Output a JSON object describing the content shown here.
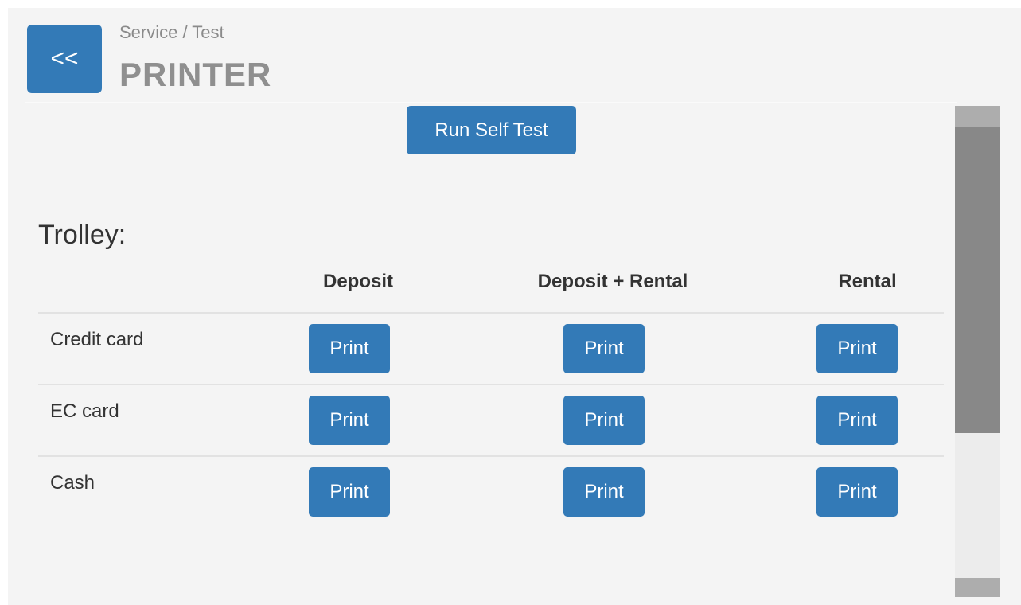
{
  "header": {
    "back_label": "<<",
    "breadcrumb": "Service / Test",
    "title": "PRINTER"
  },
  "self_test_label": "Run Self Test",
  "trolley": {
    "title": "Trolley:",
    "columns": [
      "Deposit",
      "Deposit + Rental",
      "Rental"
    ],
    "rows": [
      {
        "label": "Credit card",
        "buttons": [
          "Print",
          "Print",
          "Print"
        ]
      },
      {
        "label": "EC card",
        "buttons": [
          "Print",
          "Print",
          "Print"
        ]
      },
      {
        "label": "Cash",
        "buttons": [
          "Print",
          "Print",
          "Print"
        ]
      }
    ]
  },
  "colors": {
    "primary": "#337ab7",
    "panel_bg": "#f4f4f4",
    "title_gray": "#8f8f8f"
  }
}
